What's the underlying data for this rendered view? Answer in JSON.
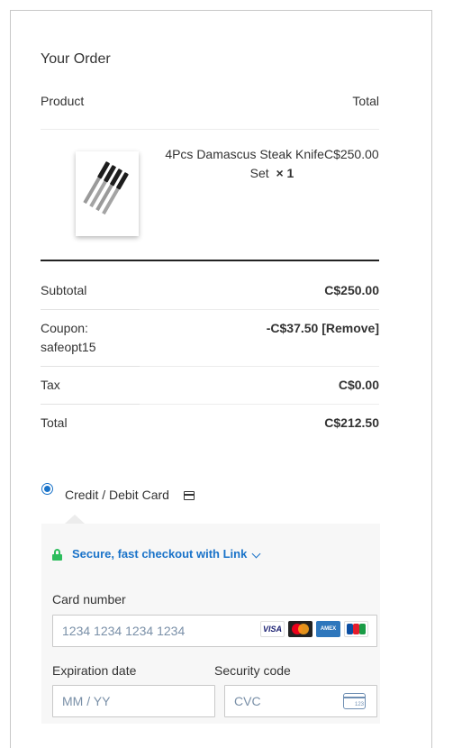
{
  "order": {
    "title": "Your Order",
    "header": {
      "product": "Product",
      "total": "Total"
    },
    "item": {
      "name": "4Pcs Damascus Steak Knife",
      "price": "C$250.00",
      "name_cont": "Set",
      "qty": "× 1"
    },
    "rows": {
      "subtotal_label": "Subtotal",
      "subtotal_value": "C$250.00",
      "coupon_label": "Coupon:",
      "coupon_code": "safeopt15",
      "coupon_value": "-C$37.50 [Remove]",
      "tax_label": "Tax",
      "tax_value": "C$0.00",
      "total_label": "Total",
      "total_value": "C$212.50"
    }
  },
  "payment": {
    "method_label": "Credit / Debit Card",
    "link_text": "Secure, fast checkout with Link",
    "card_number_label": "Card number",
    "card_number_placeholder": "1234 1234 1234 1234",
    "expiration_label": "Expiration date",
    "expiration_placeholder": "MM / YY",
    "security_label": "Security code",
    "security_placeholder": "CVC",
    "brands": {
      "visa": "VISA",
      "amex": "AMEX",
      "cvc_hint": "123"
    }
  },
  "colors": {
    "accent": "#1a73c9",
    "lock": "#2dbd5d",
    "panel_bg": "#f7f7f7"
  },
  "icons": [
    "card-icon",
    "lock-icon",
    "chevron-down-icon",
    "visa-icon",
    "mastercard-icon",
    "amex-icon",
    "jcb-icon",
    "cvc-card-icon"
  ]
}
